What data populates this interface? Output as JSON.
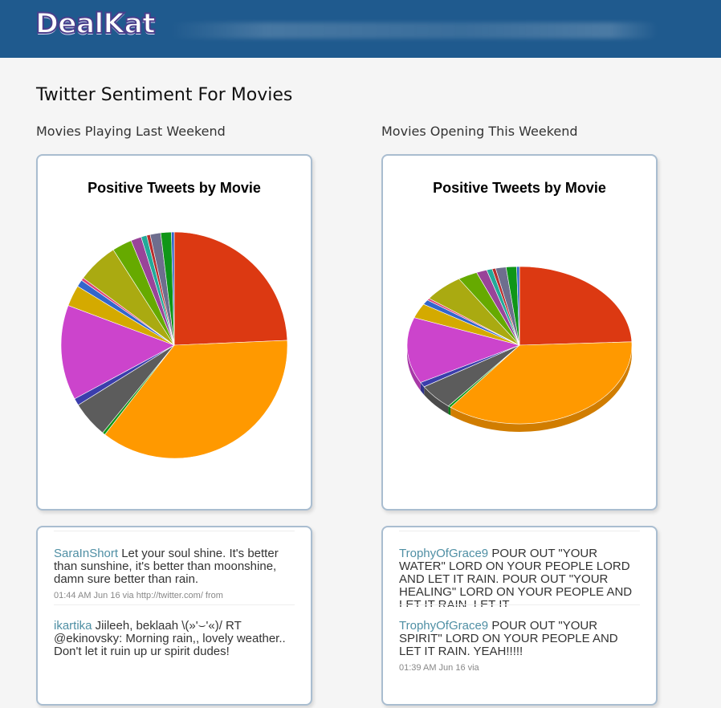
{
  "header": {
    "logo_text": "DealKat",
    "bg_color": "#1f5a8e"
  },
  "page": {
    "title": "Twitter Sentiment For Movies"
  },
  "columns": [
    {
      "heading": "Movies Playing Last Weekend",
      "chart_title": "Positive Tweets by Movie",
      "tweets": [
        {
          "user": "SaraInShort",
          "text": " Let your soul shine. It's better than sunshine, it's better than moonshine, damn sure better than rain.",
          "meta": "01:44 AM Jun 16 via http://twitter.com/ from"
        },
        {
          "user": "ikartika",
          "text": " Jiileeh, beklaah \\(»'⌣'«)/ RT @ekinovsky: Morning rain,, lovely weather.. Don't let it ruin up ur spirit dudes!",
          "meta": ""
        }
      ]
    },
    {
      "heading": "Movies Opening This Weekend",
      "chart_title": "Positive Tweets by Movie",
      "tweets": [
        {
          "user": "TrophyOfGrace9",
          "text": " POUR OUT \"YOUR WATER\" LORD ON YOUR PEOPLE LORD AND LET IT RAIN. POUR OUT \"YOUR HEALING\" LORD ON YOUR PEOPLE AND LET IT RAIN. LET IT",
          "meta": ""
        },
        {
          "user": "TrophyOfGrace9",
          "text": " POUR OUT \"YOUR SPIRIT\" LORD ON YOUR PEOPLE AND LET IT RAIN. YEAH!!!!!",
          "meta": "01:39 AM Jun 16 via"
        }
      ]
    }
  ],
  "chart_data": [
    {
      "type": "pie",
      "title": "Positive Tweets by Movie",
      "values": [
        24.2,
        36.0,
        0.4,
        5.2,
        1.0,
        13.5,
        3.0,
        1.0,
        0.4,
        5.8,
        2.8,
        1.5,
        0.8,
        0.5,
        1.5,
        1.5,
        0.4
      ],
      "colors": [
        "#dc3912",
        "#ff9900",
        "#109618",
        "#5c5c5c",
        "#3b3eac",
        "#cc44cc",
        "#d4aa00",
        "#3366cc",
        "#dd4477",
        "#aaaa11",
        "#66aa00",
        "#994499",
        "#22aa99",
        "#b82e2e",
        "#6e6e8e",
        "#109618",
        "#3366cc"
      ],
      "three_d": false
    },
    {
      "type": "pie",
      "title": "Positive Tweets by Movie",
      "values": [
        24.2,
        36.0,
        0.4,
        5.2,
        1.0,
        13.5,
        3.0,
        1.0,
        0.4,
        5.8,
        2.8,
        1.5,
        0.8,
        0.5,
        1.5,
        1.5,
        0.4
      ],
      "colors": [
        "#dc3912",
        "#ff9900",
        "#109618",
        "#5c5c5c",
        "#3b3eac",
        "#cc44cc",
        "#d4aa00",
        "#3366cc",
        "#dd4477",
        "#aaaa11",
        "#66aa00",
        "#994499",
        "#22aa99",
        "#b82e2e",
        "#6e6e8e",
        "#109618",
        "#3366cc"
      ],
      "three_d": true
    }
  ]
}
